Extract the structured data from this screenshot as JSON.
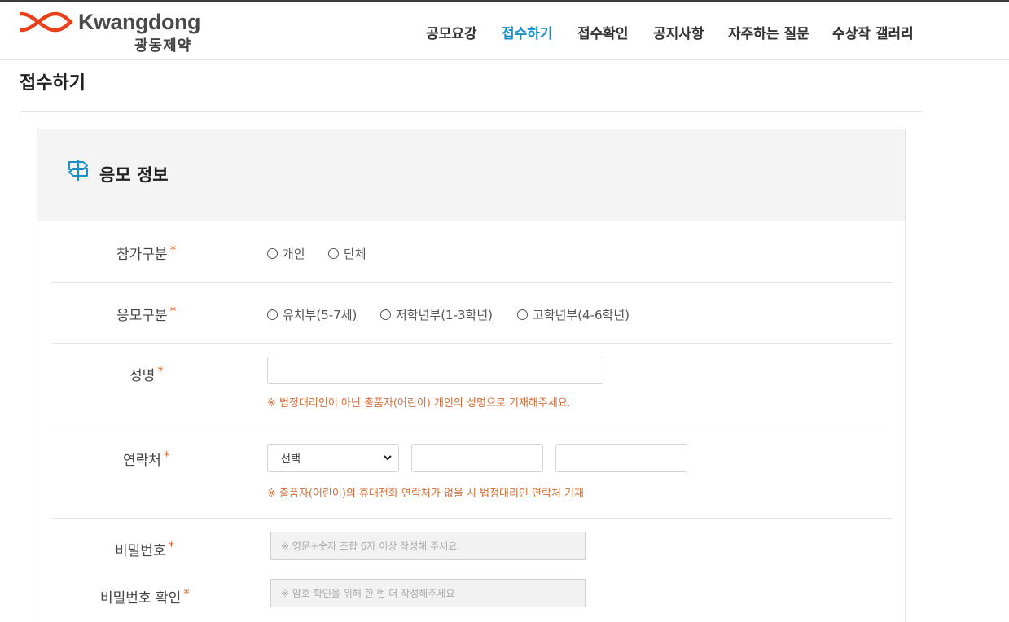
{
  "brand": {
    "name_en": "Kwangdong",
    "name_ko": "광동제약",
    "logo_color": "#e8401c"
  },
  "nav": {
    "items": [
      {
        "label": "공모요강"
      },
      {
        "label": "접수하기",
        "active": true
      },
      {
        "label": "접수확인"
      },
      {
        "label": "공지사항"
      },
      {
        "label": "자주하는 질문"
      },
      {
        "label": "수상작 갤러리"
      }
    ],
    "active_color": "#1a8fc9"
  },
  "page": {
    "title": "접수하기"
  },
  "section": {
    "title": "응모 정보",
    "icon": "signpost-icon"
  },
  "form": {
    "required_mark": "*",
    "participation": {
      "label": "참가구분",
      "options": [
        "개인",
        "단체"
      ]
    },
    "category": {
      "label": "응모구분",
      "options": [
        "유치부(5-7세)",
        "저학년부(1-3학년)",
        "고학년부(4-6학년)"
      ]
    },
    "name": {
      "label": "성명",
      "value": "",
      "note": "※ 법정대리인이 아닌 출품자(어린이) 개인의 성명으로 기재해주세요."
    },
    "contact": {
      "label": "연락처",
      "select_value": "선택",
      "part2": "",
      "part3": "",
      "note": "※ 출품자(어린이)의 휴대전화 연락처가 없을 시 법정대리인 연락처 기재"
    },
    "password": {
      "label": "비밀번호",
      "placeholder": "※ 영문+숫자 조합 6자 이상 작성해 주세요"
    },
    "password_confirm": {
      "label": "비밀번호 확인",
      "placeholder": "※ 암호 확인을 위해 한 번 더 작성해주세요"
    }
  }
}
